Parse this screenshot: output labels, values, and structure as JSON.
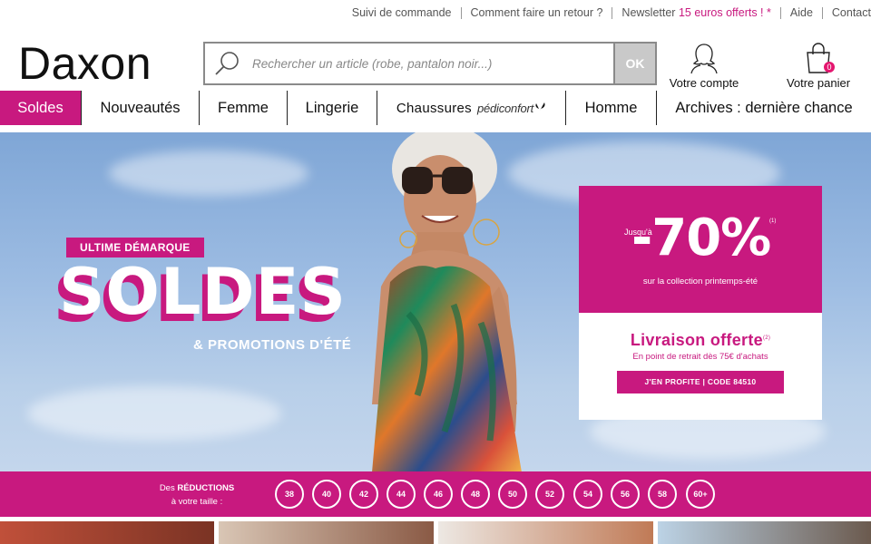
{
  "topbar": {
    "links": [
      "Suivi de commande",
      "Comment faire un retour ?"
    ],
    "newsletter": "Newsletter ",
    "newsletter_offer": "15 euros offerts ! *",
    "help": "Aide",
    "contact": "Contact"
  },
  "header": {
    "logo": "Daxon",
    "search_placeholder": "Rechercher un article (robe, pantalon noir...)",
    "search_button": "OK",
    "account_label": "Votre compte",
    "cart_label": "Votre panier",
    "cart_count": "0"
  },
  "nav": {
    "items": [
      "Soldes",
      "Nouveautés",
      "Femme",
      "Lingerie",
      "Chaussures",
      "Homme",
      "Archives : dernière chance"
    ],
    "pedi_logo": "pédiconfort"
  },
  "hero": {
    "tag": "ULTIME DÉMARQUE",
    "title": "SOLDES",
    "subtitle": "& PROMOTIONS D'ÉTÉ",
    "card": {
      "jusqu": "Jusqu'à",
      "discount": "-70%",
      "note1": "(1)",
      "collection": "sur la collection printemps-été",
      "delivery": "Livraison offerte",
      "note2": "(2)",
      "delivery_detail": "En point de retrait dès 75€ d'achats",
      "cta": "J'EN PROFITE | CODE 84510"
    }
  },
  "sizes": {
    "label_prefix": "Des ",
    "label_bold": "RÉDUCTIONS",
    "label_suffix": "à votre taille :",
    "values": [
      "38",
      "40",
      "42",
      "44",
      "46",
      "48",
      "50",
      "52",
      "54",
      "56",
      "58",
      "60+"
    ]
  },
  "colors": {
    "accent": "#c8197f",
    "badge": "#e4166f"
  }
}
